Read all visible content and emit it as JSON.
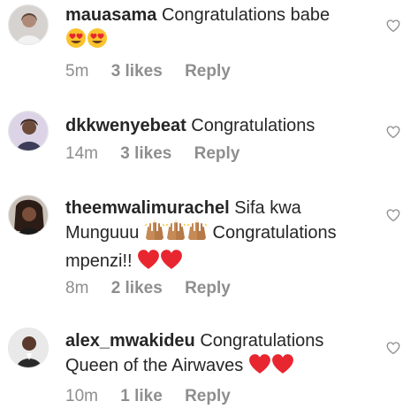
{
  "comments": [
    {
      "username": "mauasama",
      "text": "Congratulations babe",
      "emoji_trailing": [
        "heart-eyes-emoji",
        "heart-eyes-emoji"
      ],
      "time": "5m",
      "likes": "3 likes",
      "reply": "Reply"
    },
    {
      "username": "dkkwenyebeat",
      "text": "Congratulations",
      "time": "14m",
      "likes": "3 likes",
      "reply": "Reply"
    },
    {
      "username": "theemwalimurachel",
      "text_part1": "Sifa kwa",
      "text_part2": "Munguuu",
      "text_part3": "Congratulations",
      "text_part4": "mpenzi!!",
      "emoji_mid": [
        "raising-hands-emoji",
        "raising-hands-emoji",
        "raising-hands-emoji"
      ],
      "emoji_trailing": [
        "red-heart-emoji",
        "red-heart-emoji"
      ],
      "time": "8m",
      "likes": "2 likes",
      "reply": "Reply"
    },
    {
      "username": "alex_mwakideu",
      "text_part1": "Congratulations",
      "text_part2": "Queen of the Airwaves",
      "emoji_trailing": [
        "red-heart-emoji",
        "red-heart-emoji"
      ],
      "time": "10m",
      "likes": "1 like",
      "reply": "Reply"
    }
  ],
  "colors": {
    "text": "#262626",
    "meta": "#8e8e8e",
    "heart_emoji": "#e8262f",
    "heart_eyes_face": "#f9c32d"
  },
  "icons": {
    "like": "heart-outline-icon"
  }
}
